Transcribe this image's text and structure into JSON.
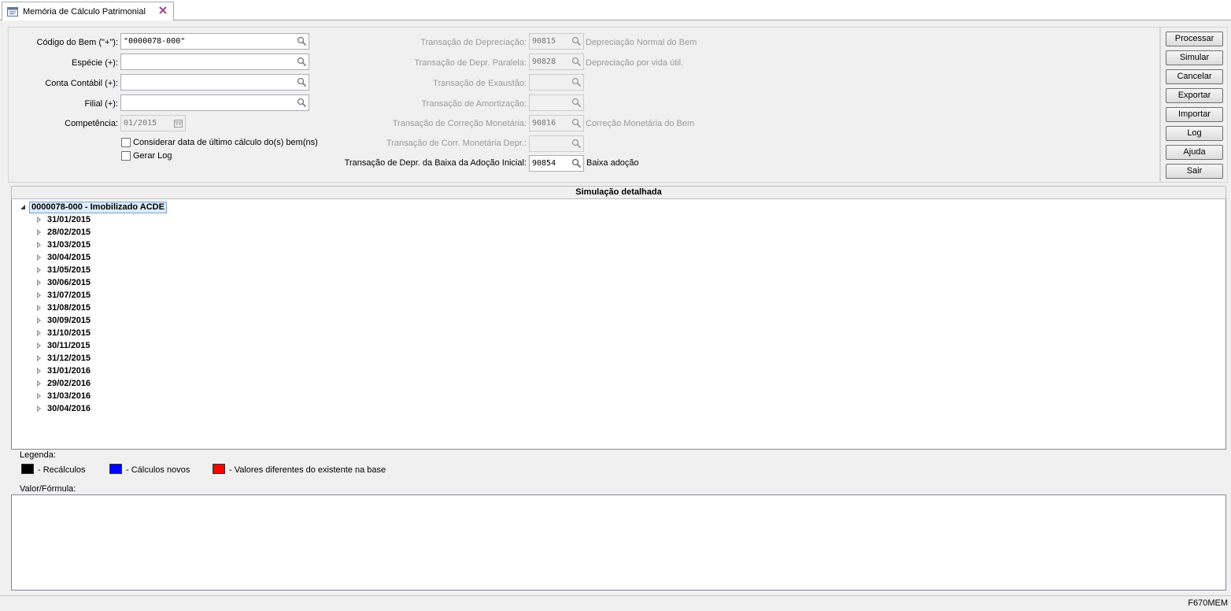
{
  "tab": {
    "title": "Memória de Cálculo Patrimonial",
    "icon": "form-window-icon",
    "close_icon": "close-x-icon"
  },
  "left_form": {
    "codigo_bem": {
      "label": "Código do Bem (\"+\"):",
      "value": "\"0000078-000\""
    },
    "especie": {
      "label": "Espécie (+):",
      "value": ""
    },
    "conta_contabil": {
      "label": "Conta Contábil (+):",
      "value": ""
    },
    "filial": {
      "label": "Filial (+):",
      "value": ""
    },
    "competencia": {
      "label": "Competência:",
      "value": "01/2015"
    },
    "considerar_data": {
      "label": "Considerar data de último cálculo do(s) bem(ns)",
      "checked": false
    },
    "gerar_log": {
      "label": "Gerar Log",
      "checked": false
    }
  },
  "right_form": {
    "depreciacao": {
      "label": "Transação de Depreciação:",
      "value": "90815",
      "desc": "Depreciação Normal do Bem"
    },
    "depr_paralela": {
      "label": "Transação de Depr. Paralela:",
      "value": "90828",
      "desc": "Depreciação por vida útil."
    },
    "exaustao": {
      "label": "Transação de Exaustão:",
      "value": "",
      "desc": ""
    },
    "amortizacao": {
      "label": "Transação de Amortização:",
      "value": "",
      "desc": ""
    },
    "correcao_monetaria": {
      "label": "Transação de Correção Monetária:",
      "value": "90816",
      "desc": "Correção Monetária do Bem"
    },
    "corr_monetaria_depr": {
      "label": "Transação de Corr. Monetária Depr.:",
      "value": "",
      "desc": ""
    },
    "baixa_adocao": {
      "label": "Transação de Depr. da Baixa da Adoção Inicial:",
      "value": "90854",
      "desc": "Baixa adoção"
    }
  },
  "buttons": [
    "Processar",
    "Simular",
    "Cancelar",
    "Exportar",
    "Importar",
    "Log",
    "Ajuda",
    "Sair"
  ],
  "tree": {
    "header": "Simulação detalhada",
    "root": "0000078-000 - Imobilizado ACDE",
    "items": [
      "31/01/2015",
      "28/02/2015",
      "31/03/2015",
      "30/04/2015",
      "31/05/2015",
      "30/06/2015",
      "31/07/2015",
      "31/08/2015",
      "30/09/2015",
      "31/10/2015",
      "30/11/2015",
      "31/12/2015",
      "31/01/2016",
      "29/02/2016",
      "31/03/2016",
      "30/04/2016"
    ]
  },
  "legend": {
    "title": "Legenda:",
    "items": [
      {
        "label": "- Recálculos",
        "color": "#000000"
      },
      {
        "label": "- Cálculos novos",
        "color": "#0000ff"
      },
      {
        "label": "- Valores diferentes do existente na base",
        "color": "#ff0000"
      }
    ]
  },
  "formula": {
    "title": "Valor/Fórmula:",
    "value": ""
  },
  "status": {
    "screen_code": "F670MEM"
  }
}
